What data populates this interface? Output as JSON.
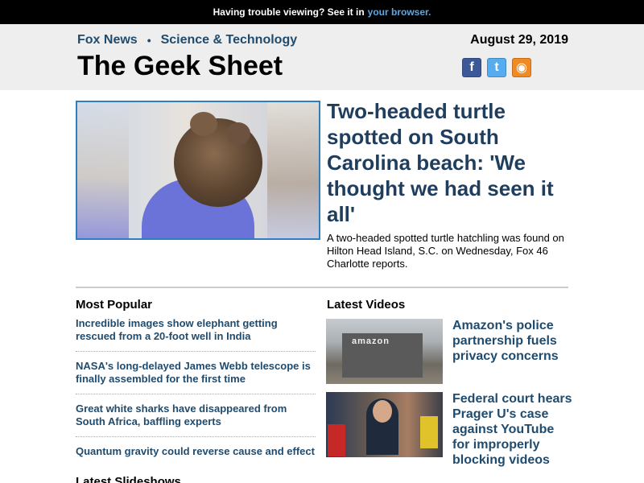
{
  "topbar": {
    "text": "Having trouble viewing? See it in",
    "link": "your browser."
  },
  "header": {
    "brand": "Fox News",
    "section": "Science & Technology",
    "title": "The Geek Sheet",
    "date": "August 29, 2019",
    "social": [
      {
        "name": "facebook-icon",
        "glyph": "f"
      },
      {
        "name": "twitter-icon",
        "glyph": "t"
      },
      {
        "name": "rss-icon",
        "glyph": "◉"
      }
    ]
  },
  "hero": {
    "headline": "Two-headed turtle spotted on South Carolina beach: 'We thought we had seen it all'",
    "summary": "A two-headed spotted turtle hatchling was found on Hilton Head Island, S.C. on Wednesday, Fox 46 Charlotte reports."
  },
  "most_popular": {
    "title": "Most Popular",
    "items": [
      "Incredible images show elephant getting rescued from a 20-foot well in India",
      "NASA's long-delayed James Webb telescope is finally assembled for the first time",
      "Great white sharks have disappeared from South Africa, baffling experts",
      "Quantum gravity could reverse cause and effect"
    ]
  },
  "latest_slideshows": {
    "title": "Latest Slideshows"
  },
  "latest_videos": {
    "title": "Latest Videos",
    "items": [
      {
        "caption": "Amazon's police partnership fuels privacy concerns",
        "thumb_text": "amazon"
      },
      {
        "caption": "Federal court hears Prager U's case against YouTube for improperly blocking videos"
      }
    ]
  }
}
